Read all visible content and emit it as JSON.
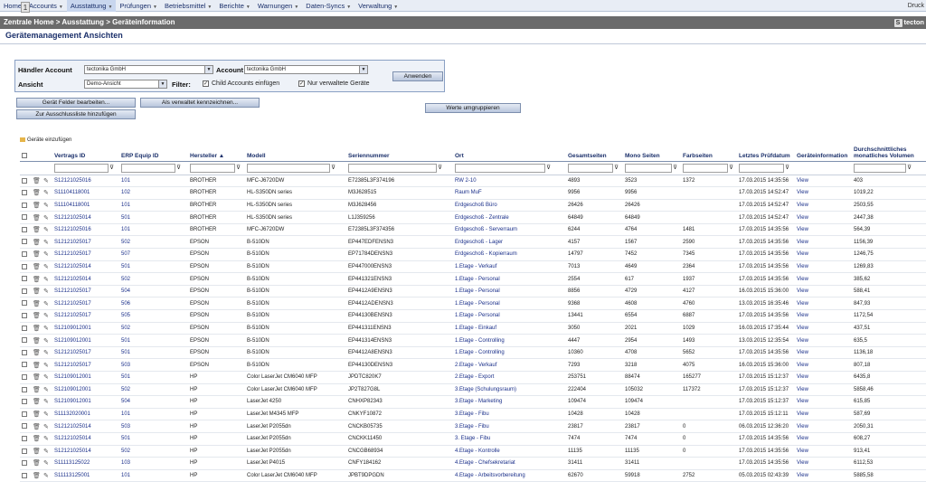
{
  "menu": {
    "items": [
      "Home",
      "Accounts",
      "Ausstattung",
      "Prüfungen",
      "Betriebsmittel",
      "Berichte",
      "Warnungen",
      "Daten-Syncs",
      "Verwaltung"
    ],
    "right": "Druck"
  },
  "breadcrumb": {
    "text": "Zentrale Home > Ausstattung > Geräteinformation",
    "badge": "1",
    "right": "tecton"
  },
  "page": {
    "title": "Gerätemanagement Ansichten"
  },
  "filter": {
    "haendler_label": "Händler Account",
    "haendler_value": "tectonika GmbH",
    "account_label": "Account",
    "account_value": "tectonika GmbH",
    "ansicht_label": "Ansicht",
    "ansicht_value": "Demo-Ansicht",
    "filter_label": "Filter:",
    "child_label": "Child Accounts einfügen",
    "verwaltet_label": "Nur verwaltete Geräte",
    "apply_label": "Anwenden"
  },
  "actions": {
    "edit_fields": "Gerät Felder bearbeiten...",
    "mark_managed": "Als verwaltet kennzeichnen...",
    "exclusion": "Zur Ausschlussliste hinzufügen",
    "regroup": "Werte umgruppieren",
    "add_devices": "Geräte einzufügen"
  },
  "grid": {
    "headers": {
      "vertrag": "Vertrags ID",
      "erp": "ERP Equip ID",
      "hersteller": "Hersteller ▲",
      "modell": "Modell",
      "serien": "Seriennummer",
      "ort": "Ort",
      "gesamt": "Gesamtseiten",
      "mono": "Mono Seiten",
      "farb": "Farbseiten",
      "datum": "Letztes Prüfdatum",
      "info": "Geräteinformation",
      "volumen": "Durchschnittliches monatliches Volumen"
    },
    "rows": [
      [
        "S12121025016",
        "101",
        "BROTHER",
        "MFC-J6720DW",
        "E72385L3F374196",
        "RW 2-10",
        "4893",
        "3523",
        "1372",
        "17.03.2015 14:35:56",
        "View",
        "403"
      ],
      [
        "S11104118001",
        "102",
        "BROTHER",
        "HL-S350DN series",
        "M3J628515",
        "Raum MuF",
        "9956",
        "9956",
        "",
        "17.03.2015 14:52:47",
        "View",
        "1019,22"
      ],
      [
        "S11104118001",
        "101",
        "BROTHER",
        "HL-S350DN series",
        "M3J628456",
        "Erdgeschoß Büro",
        "26426",
        "26426",
        "",
        "17.03.2015 14:52:47",
        "View",
        "2503,55"
      ],
      [
        "S12121025014",
        "501",
        "BROTHER",
        "HL-S350DN series",
        "L1J359256",
        "Erdgeschoß - Zentrale",
        "64849",
        "64849",
        "",
        "17.03.2015 14:52:47",
        "View",
        "2447,38"
      ],
      [
        "S12121025016",
        "101",
        "BROTHER",
        "MFC-J6720DW",
        "E72385L3F374356",
        "Erdgeschoß - Serverraum",
        "6244",
        "4764",
        "1481",
        "17.03.2015 14:35:56",
        "View",
        "564,39"
      ],
      [
        "S12121025017",
        "502",
        "EPSON",
        "B-510DN",
        "EP447EDFENSN3",
        "Erdgeschoß - Lager",
        "4157",
        "1567",
        "2590",
        "17.03.2015 14:35:56",
        "View",
        "1156,39"
      ],
      [
        "S12121025017",
        "507",
        "EPSON",
        "B-510DN",
        "EP71784DENSN3",
        "Erdgeschoß - Kopierraum",
        "14797",
        "7452",
        "7345",
        "17.03.2015 14:35:56",
        "View",
        "1246,75"
      ],
      [
        "S12121025014",
        "501",
        "EPSON",
        "B-510DN",
        "EP447000ENSN3",
        "1.Etage - Verkauf",
        "7013",
        "4649",
        "2364",
        "17.03.2015 14:35:56",
        "View",
        "1269,83"
      ],
      [
        "S12121025014",
        "502",
        "EPSON",
        "B-510DN",
        "EP441321ENSN3",
        "1.Etage - Personal",
        "2554",
        "617",
        "1937",
        "17.03.2015 14:35:56",
        "View",
        "385,62"
      ],
      [
        "S12121025017",
        "504",
        "EPSON",
        "B-510DN",
        "EP4412A9ENSN3",
        "1.Etage - Personal",
        "8856",
        "4729",
        "4127",
        "16.03.2015 15:36:00",
        "View",
        "588,41"
      ],
      [
        "S12121025017",
        "506",
        "EPSON",
        "B-510DN",
        "EP4412ADENSN3",
        "1.Etage - Personal",
        "9368",
        "4608",
        "4760",
        "13.03.2015 16:35:46",
        "View",
        "847,93"
      ],
      [
        "S12121025017",
        "505",
        "EPSON",
        "B-510DN",
        "EP44130BENSN3",
        "1.Etage - Personal",
        "13441",
        "6554",
        "6887",
        "17.03.2015 14:35:56",
        "View",
        "1172,54"
      ],
      [
        "S12109012001",
        "502",
        "EPSON",
        "B-510DN",
        "EP441311ENSN3",
        "1.Etage - Einkauf",
        "3050",
        "2021",
        "1029",
        "16.03.2015 17:35:44",
        "View",
        "437,51"
      ],
      [
        "S12109012001",
        "501",
        "EPSON",
        "B-510DN",
        "EP441314ENSN3",
        "1.Etage - Controlling",
        "4447",
        "2954",
        "1493",
        "13.03.2015 12:35:54",
        "View",
        "635,5"
      ],
      [
        "S12121025017",
        "501",
        "EPSON",
        "B-510DN",
        "EP4412A8ENSN3",
        "1.Etage - Controlling",
        "10360",
        "4708",
        "5652",
        "17.03.2015 14:35:56",
        "View",
        "1136,18"
      ],
      [
        "S12121025017",
        "503",
        "EPSON",
        "B-510DN",
        "EP44130DENSN3",
        "2.Etage - Verkauf",
        "7293",
        "3218",
        "4075",
        "16.03.2015 15:36:00",
        "View",
        "807,18"
      ],
      [
        "S12109012001",
        "501",
        "HP",
        "Color LaserJet CM6040 MFP",
        "JPDTC820K7",
        "2.Etage - Export",
        "253751",
        "88474",
        "165277",
        "17.03.2015 15:12:37",
        "View",
        "6435,8"
      ],
      [
        "S12109012001",
        "502",
        "HP",
        "Color LaserJet CM6040 MFP",
        "JP2T827G8L",
        "3.Etage (Schulungsraum)",
        "222404",
        "105032",
        "117372",
        "17.03.2015 15:12:37",
        "View",
        "5858,46"
      ],
      [
        "S12109012001",
        "504",
        "HP",
        "LaserJet 4250",
        "CNHXP82343",
        "3.Etage - Marketing",
        "109474",
        "109474",
        "",
        "17.03.2015 15:12:37",
        "View",
        "615,85"
      ],
      [
        "S11132020001",
        "101",
        "HP",
        "LaserJet M4345 MFP",
        "CNKYF10872",
        "3.Etage - Fibu",
        "10428",
        "10428",
        "",
        "17.03.2015 15:12:11",
        "View",
        "587,69"
      ],
      [
        "S12121025014",
        "503",
        "HP",
        "LaserJet P2055dn",
        "CNCKB05735",
        "3.Etage - Fibu",
        "23817",
        "23817",
        "0",
        "06.03.2015 12:36:20",
        "View",
        "2050,31"
      ],
      [
        "S12121025014",
        "501",
        "HP",
        "LaserJet P2055dn",
        "CNCKK11450",
        "3. Etage - Fibu",
        "7474",
        "7474",
        "0",
        "17.03.2015 14:35:56",
        "View",
        "608,27"
      ],
      [
        "S12121025014",
        "502",
        "HP",
        "LaserJet P2055dn",
        "CNCGB68934",
        "4.Etage - Kontrolle",
        "11135",
        "11135",
        "0",
        "17.03.2015 14:35:56",
        "View",
        "913,41"
      ],
      [
        "S11113125022",
        "103",
        "HP",
        "LaserJet P4015",
        "CNFY184162",
        "4.Etage - Chefsekretariat",
        "31411",
        "31411",
        "",
        "17.03.2015 14:35:56",
        "View",
        "6112,53"
      ],
      [
        "S11113125001",
        "101",
        "HP",
        "Color LaserJet CM6040 MFP",
        "JPBT9DPGDN",
        "4.Etage - Arbeitsvorbereitung",
        "62670",
        "59918",
        "2752",
        "05.03.2015 02:43:39",
        "View",
        "5885,58"
      ]
    ]
  }
}
